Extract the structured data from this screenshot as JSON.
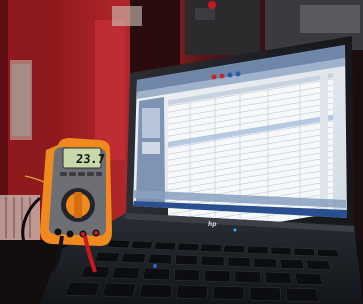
{
  "photo": {
    "meter": {
      "reading": "23.7",
      "display_color": "#c9d8a8",
      "body_color": "#f08a1e",
      "icon": "multimeter-icon"
    },
    "laptop": {
      "brand": "hp",
      "screen_color": "#e8edf3",
      "icon": "laptop-icon"
    },
    "colors": {
      "ambient_red": "#b0262a",
      "keyboard": "#1c1f24"
    }
  }
}
